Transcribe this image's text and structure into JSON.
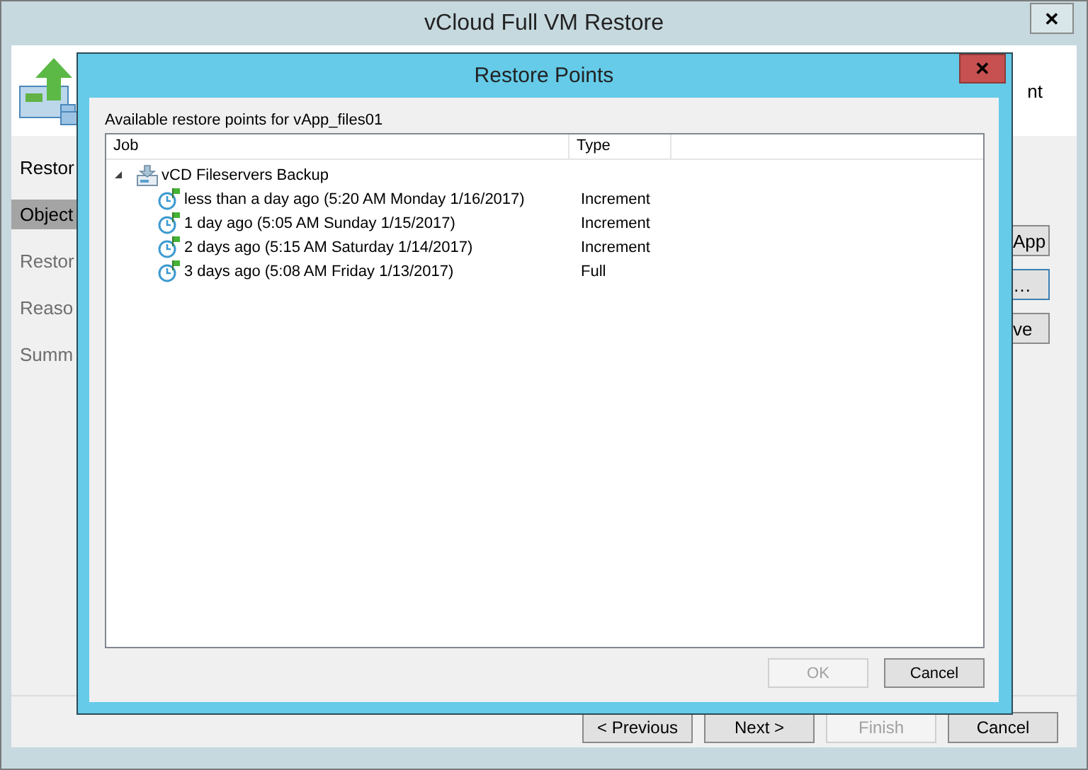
{
  "window": {
    "title": "vCloud Full VM Restore",
    "close": "✕",
    "header_text": "nt"
  },
  "steps": [
    {
      "label": "Restor",
      "selected": false,
      "disabled": false
    },
    {
      "label": "Object",
      "selected": true,
      "disabled": false
    },
    {
      "label": "Restor",
      "selected": false,
      "disabled": true
    },
    {
      "label": "Reaso",
      "selected": false,
      "disabled": true
    },
    {
      "label": "Summ",
      "selected": false,
      "disabled": true
    }
  ],
  "side_buttons": [
    {
      "label": "App",
      "focused": false
    },
    {
      "label": "…",
      "focused": true
    },
    {
      "label": "ve",
      "focused": false
    }
  ],
  "wizard_buttons": [
    {
      "label": "< Previous",
      "disabled": false
    },
    {
      "label": "Next >",
      "disabled": false
    },
    {
      "label": "Finish",
      "disabled": true
    },
    {
      "label": "Cancel",
      "disabled": false
    }
  ],
  "dialog": {
    "title": "Restore Points",
    "close": "✕",
    "caption": "Available restore points for vApp_files01",
    "columns": [
      "Job",
      "Type"
    ],
    "tree": [
      {
        "label": "vCD Fileservers Backup",
        "expanded": true,
        "children": [
          {
            "label": "less than a day ago (5:20 AM Monday 1/16/2017)",
            "type": "Increment"
          },
          {
            "label": "1 day ago (5:05 AM Sunday 1/15/2017)",
            "type": "Increment"
          },
          {
            "label": "2 days ago (5:15 AM Saturday 1/14/2017)",
            "type": "Increment"
          },
          {
            "label": "3 days ago (5:08 AM Friday 1/13/2017)",
            "type": "Full"
          }
        ]
      }
    ],
    "buttons": [
      {
        "label": "OK",
        "disabled": true
      },
      {
        "label": "Cancel",
        "disabled": false
      }
    ]
  }
}
